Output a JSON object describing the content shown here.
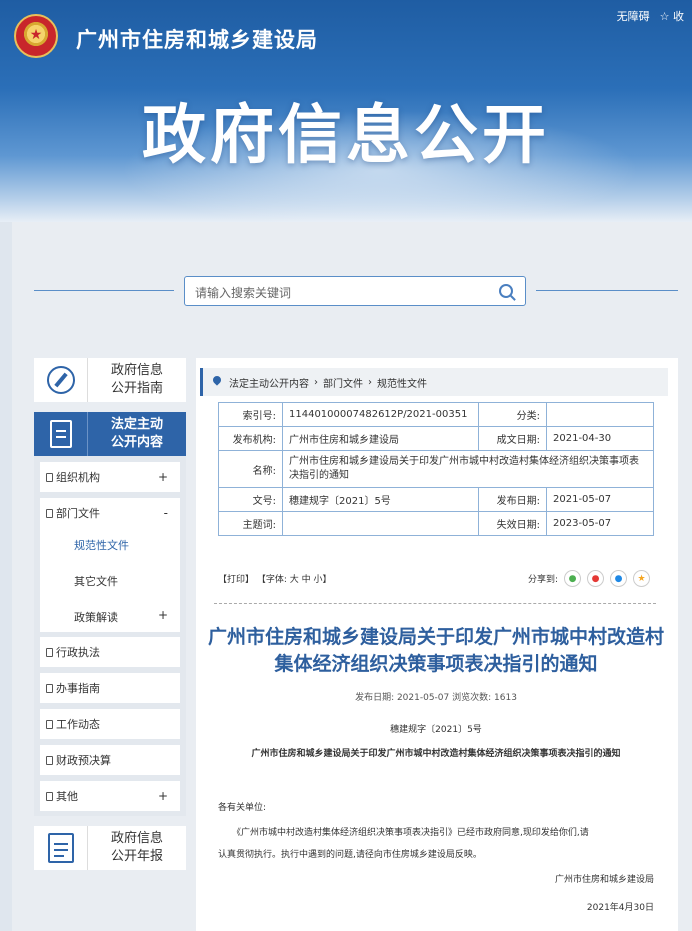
{
  "header": {
    "site_title": "广州市住房和城乡建设局",
    "banner_title": "政府信息公开",
    "top_links": [
      "无障碍",
      "☆ 收"
    ]
  },
  "search": {
    "placeholder": "请输入搜索关键词"
  },
  "sidebar": {
    "guide": "政府信息\n公开指南",
    "active": "法定主动\n公开内容",
    "annual": "政府信息\n公开年报",
    "menu": [
      {
        "label": "组织机构",
        "toggle": "+"
      },
      {
        "label": "部门文件",
        "toggle": "-"
      },
      {
        "label": "行政执法",
        "toggle": ""
      },
      {
        "label": "办事指南",
        "toggle": ""
      },
      {
        "label": "工作动态",
        "toggle": ""
      },
      {
        "label": "财政预决算",
        "toggle": ""
      },
      {
        "label": "其他",
        "toggle": "+"
      }
    ],
    "sub": [
      {
        "label": "规范性文件"
      },
      {
        "label": "其它文件"
      },
      {
        "label": "政策解读",
        "toggle": "+"
      }
    ]
  },
  "breadcrumb": [
    "法定主动公开内容",
    "部门文件",
    "规范性文件"
  ],
  "meta": {
    "index_label": "索引号:",
    "index_value": "11440100007482612P/2021-00351",
    "category_label": "分类:",
    "category_value": "",
    "publisher_label": "发布机构:",
    "publisher_value": "广州市住房和城乡建设局",
    "written_label": "成文日期:",
    "written_value": "2021-04-30",
    "name_label": "名称:",
    "name_value": "广州市住房和城乡建设局关于印发广州市城中村改造村集体经济组织决策事项表决指引的通知",
    "docno_label": "文号:",
    "docno_value": "穗建规字〔2021〕5号",
    "publish_label": "发布日期:",
    "publish_value": "2021-05-07",
    "subject_label": "主题词:",
    "subject_value": "",
    "expire_label": "失效日期:",
    "expire_value": "2023-05-07"
  },
  "tools": {
    "print": "【打印】",
    "font": "【字体: 大 中 小】",
    "share": "分享到:"
  },
  "article": {
    "title": "广州市住房和城乡建设局关于印发广州市城中村改造村集体经济组织决策事项表决指引的通知",
    "meta": "发布日期: 2021-05-07 浏览次数: 1613",
    "doc_no": "穗建规字〔2021〕5号",
    "doc_title": "广州市住房和城乡建设局关于印发广州市城中村改造村集体经济组织决策事项表决指引的通知",
    "salutation": "各有关单位:",
    "para1": "《广州市城中村改造村集体经济组织决策事项表决指引》已经市政府同意,现印发给你们,请",
    "para2": "认真贯彻执行。执行中遇到的问题,请径向市住房城乡建设局反映。",
    "signer": "广州市住房和城乡建设局",
    "date": "2021年4月30日"
  },
  "colors": {
    "primary": "#2e64a8",
    "title_blue": "#2e5f9e",
    "border_blue": "#8fb2d8"
  }
}
